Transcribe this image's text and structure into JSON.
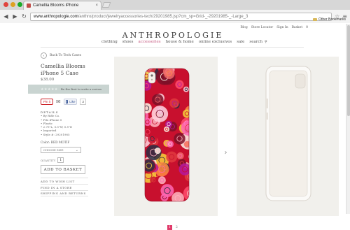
{
  "browser": {
    "tab_title": "Camellia Blooms iPhone",
    "tab_close": "×",
    "url_host": "www.anthropologie.com",
    "url_path": "/anthro/product/jewelryaccessories-tech/29201985.jsp?cm_sp=Grid-_-29201985-_-Large_3",
    "bookmarks_label": "Other Bookmarks",
    "back": "◀",
    "forward": "▶",
    "reload": "↻",
    "star": "☆",
    "wrench": "≡",
    "traffic": {
      "close": "#e0443e",
      "minimize": "#dea123",
      "zoom": "#1aab29"
    }
  },
  "header": {
    "utility": [
      "Blog",
      "Store Locator",
      "Sign In",
      "Basket",
      "0"
    ],
    "logo": "ANTHROPOLOGIE",
    "nav": [
      {
        "label": "clothing",
        "active": false
      },
      {
        "label": "shoes",
        "active": false
      },
      {
        "label": "accessories",
        "active": true
      },
      {
        "label": "house & home",
        "active": false
      },
      {
        "label": "online exclusives",
        "active": false
      },
      {
        "label": "sale",
        "active": false
      },
      {
        "label": "search",
        "active": false
      }
    ],
    "search_icon": "⚲"
  },
  "product": {
    "back_label": "Back To Tech Cases",
    "back_icon": "‹",
    "title": "Camellia Blooms iPhone 5 Case",
    "price": "$38.00",
    "stars": "★★★★★",
    "review_text": "Be the first to write a review",
    "share": {
      "pin": "Pin it",
      "mail_icon": "✉",
      "fb_f": "f",
      "fb_like": "Like",
      "fb_count": "2"
    },
    "details_heading": "DETAILS",
    "details": [
      "By Rifle Co.",
      "Fits iPhone 5",
      "Plastic",
      "2.75\"L, 5.5\"W, 0.5\"D",
      "Imported",
      "Style #: 29201985"
    ],
    "color": "Color: RED MOTIF",
    "size_placeholder": "CHOOSE SIZE",
    "size_chevron": "⌄",
    "qty_label": "QUANTITY",
    "qty_value": "1",
    "add_to_basket": "ADD TO BASKET",
    "actions": [
      "ADD TO WISH LIST",
      "FIND IN A STORE",
      "SHIPPING AND RETURNS"
    ]
  },
  "gallery": {
    "next_arrow": "›",
    "pages": [
      "1",
      "2"
    ],
    "active_page": 1,
    "case_colors": [
      "#c8102e",
      "#e03a3e",
      "#f26b6b",
      "#f6d13a",
      "#ffb6c1",
      "#ff69b4",
      "#ff8c42",
      "#7d1128",
      "#fdf5e6",
      "#ff4d6d",
      "#ffd6e0",
      "#b5179e",
      "#2b2d42"
    ]
  }
}
